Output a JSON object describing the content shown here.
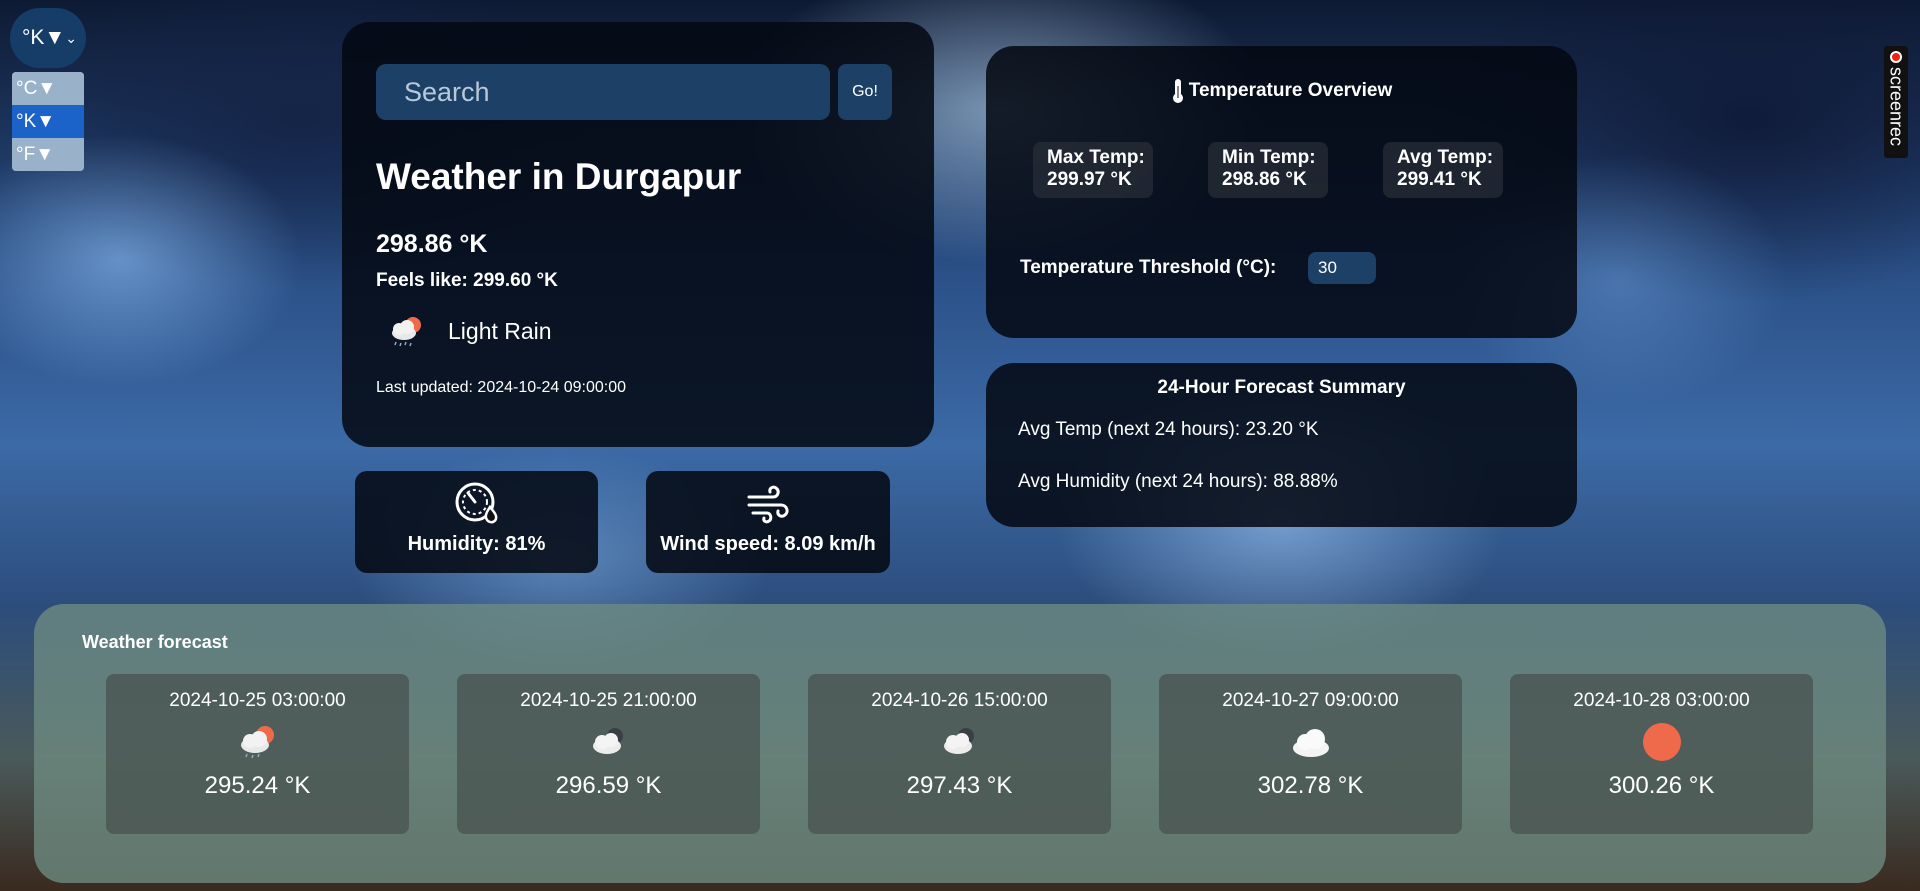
{
  "unit_select": {
    "current": "°K▼",
    "options": [
      "°C▼",
      "°K▼",
      "°F▼"
    ]
  },
  "screenrec": {
    "label": "screenrec"
  },
  "search": {
    "placeholder": "Search",
    "button_label": "Go!"
  },
  "current_weather": {
    "title": "Weather in Durgapur",
    "temperature": "298.86 °K",
    "feels_like": "Feels like: 299.60 °K",
    "condition": "Light Rain",
    "condition_icon": "cloud-sun-rain-icon",
    "last_updated": "Last updated: 2024-10-24 09:00:00"
  },
  "humidity": {
    "label": "Humidity: 81%",
    "icon": "humidity-gauge-icon"
  },
  "wind": {
    "label": "Wind speed: 8.09 km/h",
    "icon": "wind-icon"
  },
  "temperature_overview": {
    "title": "Temperature Overview",
    "icon": "thermometer-icon",
    "max_label": "Max Temp:",
    "max_value": "299.97 °K",
    "min_label": "Min Temp:",
    "min_value": "298.86 °K",
    "avg_label": "Avg Temp:",
    "avg_value": "299.41 °K",
    "threshold_label": "Temperature Threshold (°C):",
    "threshold_value": "30"
  },
  "forecast_24h": {
    "title": "24-Hour Forecast Summary",
    "avg_temp": "Avg Temp (next 24 hours): 23.20 °K",
    "avg_humidity": "Avg Humidity (next 24 hours): 88.88%"
  },
  "forecast": {
    "heading": "Weather forecast",
    "items": [
      {
        "date": "2024-10-25 03:00:00",
        "temp": "295.24 °K",
        "icon": "cloud-sun-rain-icon"
      },
      {
        "date": "2024-10-25 21:00:00",
        "temp": "296.59 °K",
        "icon": "cloud-moon-icon"
      },
      {
        "date": "2024-10-26 15:00:00",
        "temp": "297.43 °K",
        "icon": "cloud-moon-icon"
      },
      {
        "date": "2024-10-27 09:00:00",
        "temp": "302.78 °K",
        "icon": "cloud-icon"
      },
      {
        "date": "2024-10-28 03:00:00",
        "temp": "300.26 °K",
        "icon": "sun-icon"
      }
    ]
  },
  "colors": {
    "accent": "#1d4066",
    "selected_option": "#1c63c9",
    "sun": "#ef6a4a"
  }
}
